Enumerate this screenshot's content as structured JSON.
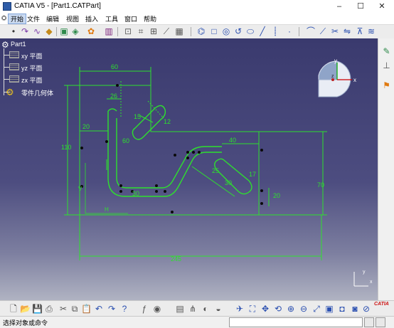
{
  "window": {
    "title": "CATIA V5 - [Part1.CATPart]",
    "min_glyph": "–",
    "max_glyph": "☐",
    "close_glyph": "✕"
  },
  "menu": [
    "开始",
    "文件",
    "编辑",
    "视图",
    "插入",
    "工具",
    "窗口",
    "帮助"
  ],
  "tree": {
    "root": "Part1",
    "items": [
      "xy 平面",
      "yz 平面",
      "zx 平面",
      "零件几何体"
    ]
  },
  "compass": {
    "x_label": "x",
    "y_label": "y",
    "z_label": "z"
  },
  "axis": {
    "x_label": "x",
    "y_label": "y"
  },
  "dimensions": {
    "d60": "60",
    "d26": "26",
    "d15": "15",
    "d12": "12",
    "d20": "20",
    "d110": "110",
    "d60b": "60",
    "d40": "40",
    "d17": "17",
    "d70": "70",
    "d20b": "20",
    "d30": "30",
    "d25": "25",
    "d30b": "30",
    "d245": "245",
    "v_label": "V",
    "h_label": "H"
  },
  "colors": {
    "sketch": "#2ee02e",
    "background_top": "#3a3a6e",
    "background_bottom": "#b0b3c2"
  },
  "status": {
    "prompt": "选择对象或命令",
    "command_value": ""
  },
  "logo_text": "CATIA"
}
